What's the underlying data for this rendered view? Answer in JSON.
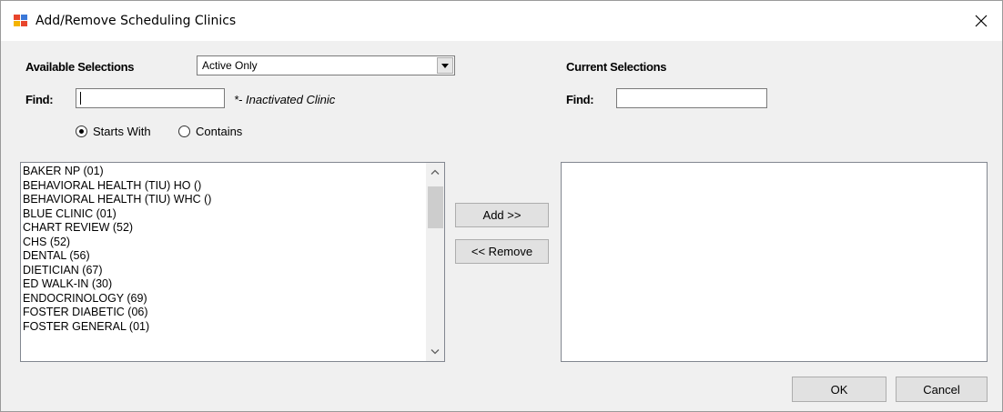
{
  "window": {
    "title": "Add/Remove Scheduling Clinics"
  },
  "available": {
    "heading": "Available Selections",
    "filter_selected": "Active Only",
    "find_label": "Find:",
    "find_value": "",
    "inactive_note": "*- Inactivated Clinic",
    "radio_starts_with": "Starts With",
    "radio_contains": "Contains",
    "radio_selected": "starts_with",
    "items": [
      "BAKER NP (01)",
      "BEHAVIORAL HEALTH (TIU) HO ()",
      "BEHAVIORAL HEALTH (TIU) WHC ()",
      "BLUE CLINIC (01)",
      "CHART REVIEW (52)",
      "CHS (52)",
      "DENTAL (56)",
      "DIETICIAN (67)",
      "ED WALK-IN (30)",
      "ENDOCRINOLOGY (69)",
      "FOSTER DIABETIC (06)",
      "FOSTER GENERAL (01)"
    ]
  },
  "current": {
    "heading": "Current Selections",
    "find_label": "Find:",
    "find_value": "",
    "items": []
  },
  "buttons": {
    "add": "Add >>",
    "remove": "<< Remove",
    "ok": "OK",
    "cancel": "Cancel"
  },
  "icons": {
    "app": "app-window-icon",
    "close": "close-icon",
    "dropdown": "chevron-down-icon",
    "scroll_up": "scroll-up-icon",
    "scroll_down": "scroll-down-icon"
  }
}
